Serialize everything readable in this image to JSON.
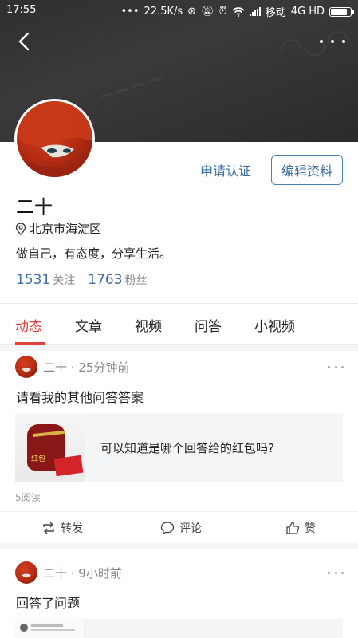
{
  "status_bar": {
    "time": "17:55",
    "dots": "•••",
    "speed": "22.5K/s",
    "carrier": "移动",
    "network": "4G HD",
    "battery_level": 0.9
  },
  "profile": {
    "name": "二十",
    "location": "北京市海淀区",
    "bio": "做自己，有态度，分享生活。",
    "following_count": "1531",
    "following_label": "关注",
    "followers_count": "1763",
    "followers_label": "粉丝",
    "verify_label": "申请认证",
    "edit_label": "编辑资料"
  },
  "tabs": [
    {
      "label": "动态",
      "active": true
    },
    {
      "label": "文章",
      "active": false
    },
    {
      "label": "视频",
      "active": false
    },
    {
      "label": "问答",
      "active": false
    },
    {
      "label": "小视频",
      "active": false
    }
  ],
  "posts": [
    {
      "meta": "二十 · 25分钟前",
      "text": "请看我的其他问答答案",
      "card_text": "可以知道是哪个回答给的红包吗?",
      "card_thumb_label": "红包",
      "reads": "5阅读",
      "actions": {
        "share": "转发",
        "comment": "评论",
        "like": "赞"
      }
    },
    {
      "meta": "二十 · 9小时前",
      "text": "回答了问题"
    }
  ],
  "colors": {
    "accent_red": "#e2423c",
    "link_blue": "#3c6ea1",
    "banner_dark": "#333333"
  }
}
